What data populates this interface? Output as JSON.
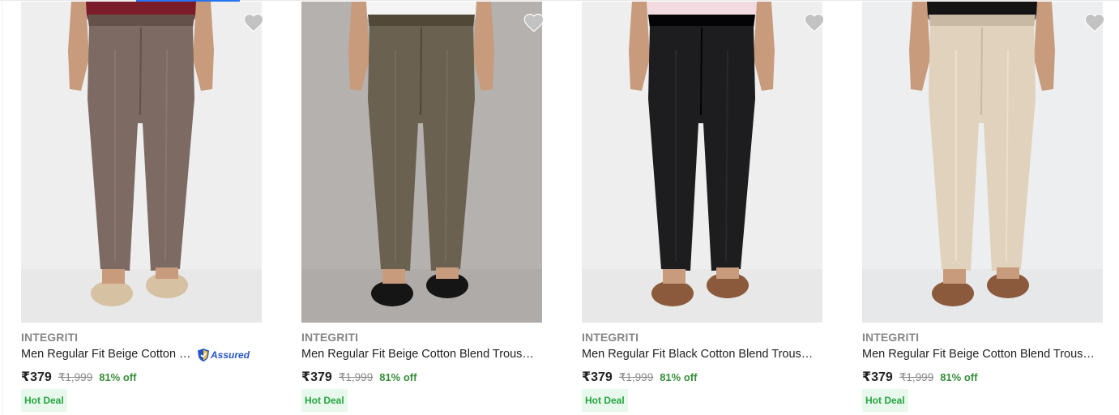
{
  "products": [
    {
      "brand": "INTEGRITI",
      "title": "Men Regular Fit Beige Cotton Blend Trousers",
      "assured_label": "Assured",
      "price": "₹379",
      "mrp": "₹1,999",
      "discount": "81% off",
      "badge": "Hot Deal",
      "trouser_color": "#7c6a63",
      "background_color": "#eeeeee",
      "shoe_color": "#d6c2a2",
      "shirt_color": "#7a1c2a"
    },
    {
      "brand": "INTEGRITI",
      "title": "Men Regular Fit Beige Cotton Blend Trousers",
      "price": "₹379",
      "mrp": "₹1,999",
      "discount": "81% off",
      "badge": "Hot Deal",
      "trouser_color": "#6a6150",
      "background_color": "#b5b1ae",
      "shoe_color": "#151515",
      "shirt_color": "#f4f4f4"
    },
    {
      "brand": "INTEGRITI",
      "title": "Men Regular Fit Black Cotton Blend Trousers",
      "price": "₹379",
      "mrp": "₹1,999",
      "discount": "81% off",
      "badge": "Hot Deal",
      "trouser_color": "#1d1d1f",
      "background_color": "#eeeeee",
      "shoe_color": "#8b5a3c",
      "shirt_color": "#f1dbe0"
    },
    {
      "brand": "INTEGRITI",
      "title": "Men Regular Fit Beige Cotton Blend Trousers",
      "price": "₹379",
      "mrp": "₹1,999",
      "discount": "81% off",
      "badge": "Hot Deal",
      "trouser_color": "#e1d2bd",
      "background_color": "#eceef0",
      "shoe_color": "#8b5a3c",
      "shirt_color": "#141414"
    }
  ],
  "icons": {
    "wishlist": "heart-icon",
    "assured": "shield-icon"
  },
  "colors": {
    "accent": "#2874f0",
    "discount": "#388e3c",
    "badge_bg": "#e8f8ec",
    "badge_text": "#26a541"
  }
}
